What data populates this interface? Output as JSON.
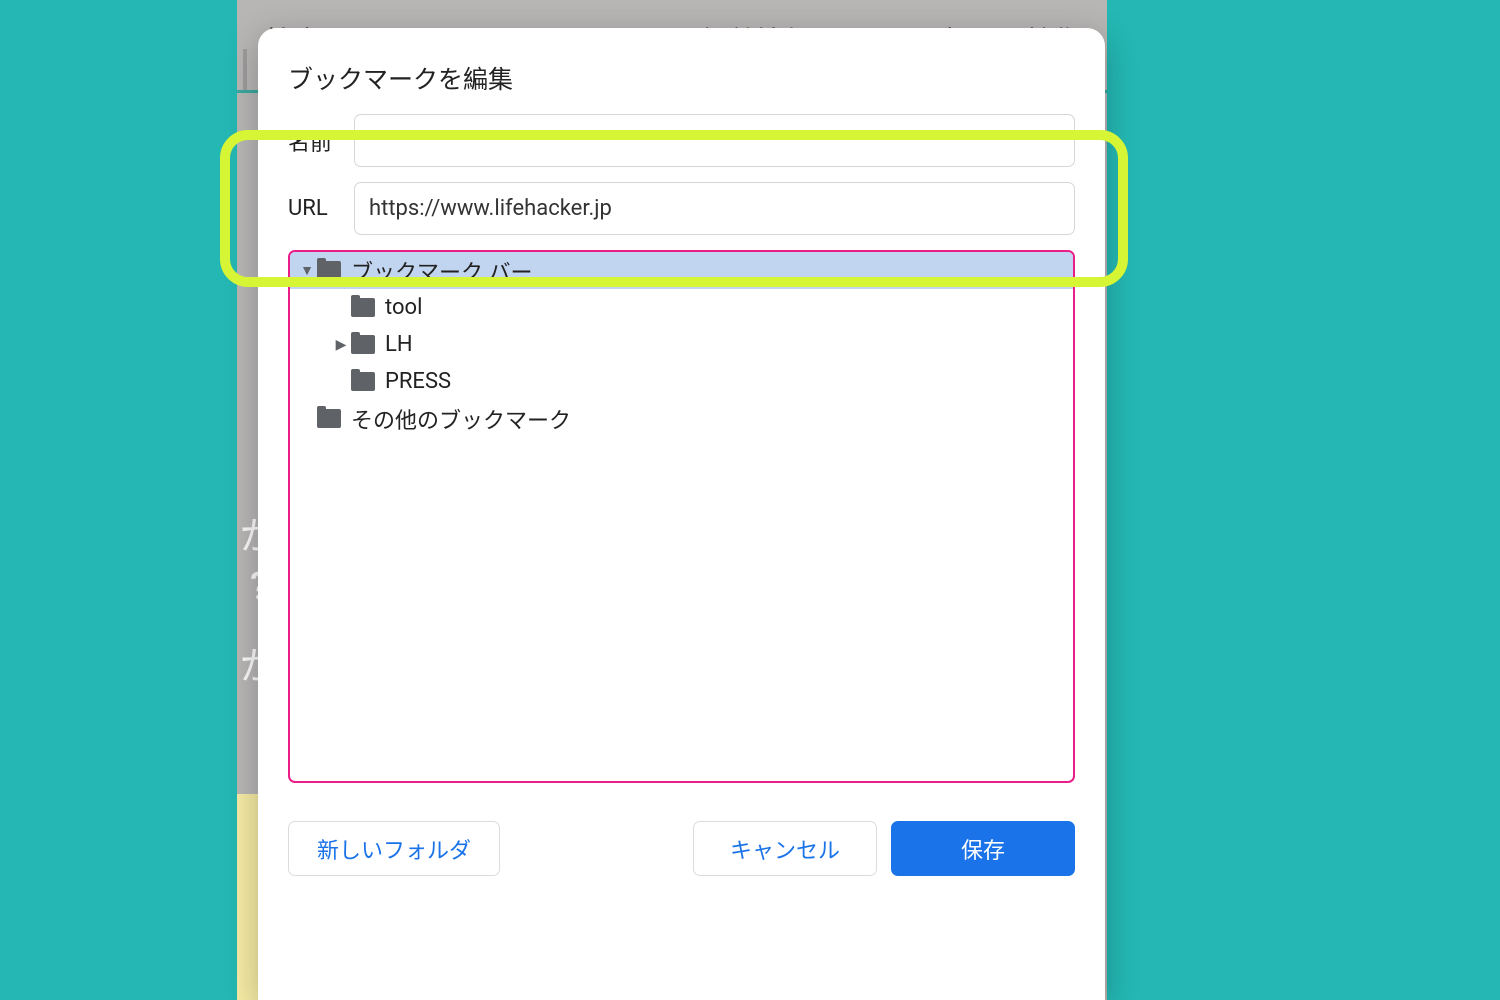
{
  "backdrop": {
    "search": "検索",
    "nav1": "新着情報",
    "nav2": "カテゴリ",
    "nav3": "特集",
    "q1": "が",
    "q2": "?",
    "q3": "が"
  },
  "dialog": {
    "title": "ブックマークを編集",
    "form": {
      "name_label": "名前",
      "name_value": "",
      "url_label": "URL",
      "url_value": "https://www.lifehacker.jp"
    },
    "tree": [
      {
        "label": "ブックマーク バー",
        "indent": 0,
        "arrow": "down",
        "selected": true
      },
      {
        "label": "tool",
        "indent": 1,
        "arrow": "none",
        "selected": false
      },
      {
        "label": "LH",
        "indent": 1,
        "arrow": "right",
        "selected": false
      },
      {
        "label": "PRESS",
        "indent": 1,
        "arrow": "none",
        "selected": false
      },
      {
        "label": "その他のブックマーク",
        "indent": 0,
        "arrow": "none",
        "selected": false
      }
    ],
    "buttons": {
      "new_folder": "新しいフォルダ",
      "cancel": "キャンセル",
      "save": "保存"
    }
  }
}
